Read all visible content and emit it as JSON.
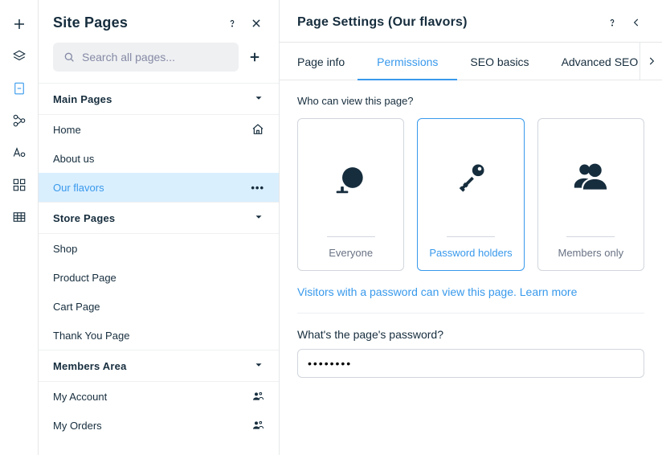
{
  "rail": {
    "items": [
      "add-icon",
      "layers-icon",
      "page-icon",
      "links-icon",
      "typography-icon",
      "grid-icon",
      "table-icon"
    ],
    "activeIndex": 2
  },
  "pages": {
    "title": "Site Pages",
    "search_placeholder": "Search all pages...",
    "sections": [
      {
        "name": "Main Pages",
        "items": [
          {
            "label": "Home",
            "rightIcon": "home-icon"
          },
          {
            "label": "About us"
          },
          {
            "label": "Our flavors",
            "selected": true,
            "rightIcon": "more-icon"
          }
        ]
      },
      {
        "name": "Store Pages",
        "items": [
          {
            "label": "Shop"
          },
          {
            "label": "Product Page"
          },
          {
            "label": "Cart Page"
          },
          {
            "label": "Thank You Page"
          }
        ]
      },
      {
        "name": "Members Area",
        "items": [
          {
            "label": "My Account",
            "rightIcon": "members-icon"
          },
          {
            "label": "My Orders",
            "rightIcon": "members-icon"
          }
        ]
      }
    ]
  },
  "settings": {
    "title": "Page Settings (Our flavors)",
    "tabs": [
      "Page info",
      "Permissions",
      "SEO basics",
      "Advanced SEO"
    ],
    "activeTab": 1,
    "permissions": {
      "question": "Who can view this page?",
      "options": [
        {
          "label": "Everyone",
          "icon": "globe-icon"
        },
        {
          "label": "Password holders",
          "icon": "key-icon",
          "selected": true
        },
        {
          "label": "Members only",
          "icon": "members-icon"
        }
      ],
      "help_pre": "Visitors with a password can view this page. ",
      "help_link": "Learn more",
      "password_label": "What's the page's password?",
      "password_value": "••••••••"
    }
  }
}
